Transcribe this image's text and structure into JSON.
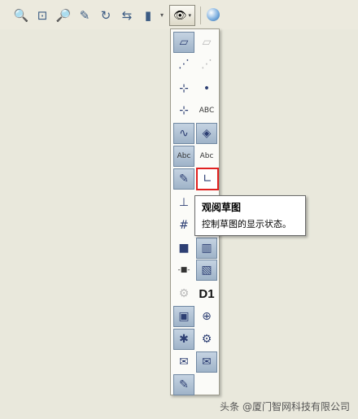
{
  "toolbar": {
    "icons": [
      {
        "name": "zoom-to-fit-icon",
        "glyph": "🔍"
      },
      {
        "name": "zoom-to-area-icon",
        "glyph": "⊡"
      },
      {
        "name": "zoom-in-out-icon",
        "glyph": "🔎"
      },
      {
        "name": "zoom-to-selection-icon",
        "glyph": "✎"
      },
      {
        "name": "rotate-view-icon",
        "glyph": "↻"
      },
      {
        "name": "previous-view-icon",
        "glyph": "⇆"
      },
      {
        "name": "view-orientation-icon",
        "glyph": "▮"
      }
    ],
    "eye_glyph": "👁",
    "caret_glyph": "▾"
  },
  "palette": {
    "items": [
      {
        "name": "view-planes-icon",
        "glyph": "▱",
        "state": "on"
      },
      {
        "name": "view-planes-alt-icon",
        "glyph": "▱",
        "state": "dis"
      },
      {
        "name": "view-axes-icon",
        "glyph": "⋰",
        "state": "off"
      },
      {
        "name": "view-temp-axes-icon",
        "glyph": "⋰",
        "state": "dis"
      },
      {
        "name": "view-origins-icon",
        "glyph": "⊹",
        "state": "off"
      },
      {
        "name": "view-points-icon",
        "glyph": "•",
        "state": "off"
      },
      {
        "name": "view-coordinate-systems-icon",
        "glyph": "⊹",
        "state": "off"
      },
      {
        "name": "view-dimension-names-icon",
        "glyph": "ABC",
        "state": "off"
      },
      {
        "name": "view-curves-icon",
        "glyph": "∿",
        "state": "on"
      },
      {
        "name": "view-parting-lines-icon",
        "glyph": "◈",
        "state": "on"
      },
      {
        "name": "view-annotations-icon",
        "glyph": "Abc",
        "state": "on"
      },
      {
        "name": "view-feature-dimensions-icon",
        "glyph": "Abc",
        "state": "off"
      },
      {
        "name": "view-sketch-relations-icon",
        "glyph": "✎",
        "state": "on"
      },
      {
        "name": "view-sketches-icon",
        "glyph": "∟",
        "state": "hl"
      },
      {
        "name": "view-grid-snap-icon",
        "glyph": "⊥",
        "state": "off"
      },
      {
        "name": "view-sketch-hidden-icon",
        "glyph": "⋯",
        "state": "off"
      },
      {
        "name": "view-grid-icon",
        "glyph": "#",
        "state": "off"
      },
      {
        "name": "view-blank-icon",
        "glyph": "",
        "state": "off"
      },
      {
        "name": "view-cameras-icon",
        "glyph": "■",
        "state": "off"
      },
      {
        "name": "view-weldments-icon",
        "glyph": "▥",
        "state": "on"
      },
      {
        "name": "view-routing-points-icon",
        "glyph": "-■-",
        "state": "off"
      },
      {
        "name": "view-cosmetic-threads-icon",
        "glyph": "▧",
        "state": "on"
      },
      {
        "name": "view-decals-icon",
        "glyph": "⚙",
        "state": "dis"
      },
      {
        "name": "view-dimension-names-d1-icon",
        "glyph": "D1",
        "state": "off"
      },
      {
        "name": "view-lights-icon",
        "glyph": "▣",
        "state": "on"
      },
      {
        "name": "view-center-of-mass-icon",
        "glyph": "⊕",
        "state": "off"
      },
      {
        "name": "view-bolts-icon",
        "glyph": "✱",
        "state": "on"
      },
      {
        "name": "view-gears-icon",
        "glyph": "⚙",
        "state": "off"
      },
      {
        "name": "view-mail-icon",
        "glyph": "✉",
        "state": "off"
      },
      {
        "name": "view-mail-alt-icon",
        "glyph": "✉",
        "state": "on"
      },
      {
        "name": "view-live-section-icon",
        "glyph": "✎",
        "state": "on"
      },
      {
        "name": "view-empty-slot",
        "glyph": "",
        "state": "none"
      }
    ]
  },
  "tooltip": {
    "title": "观阅草图",
    "body": "控制草图的显示状态。"
  },
  "watermark": "头条 @厦门智网科技有限公司"
}
